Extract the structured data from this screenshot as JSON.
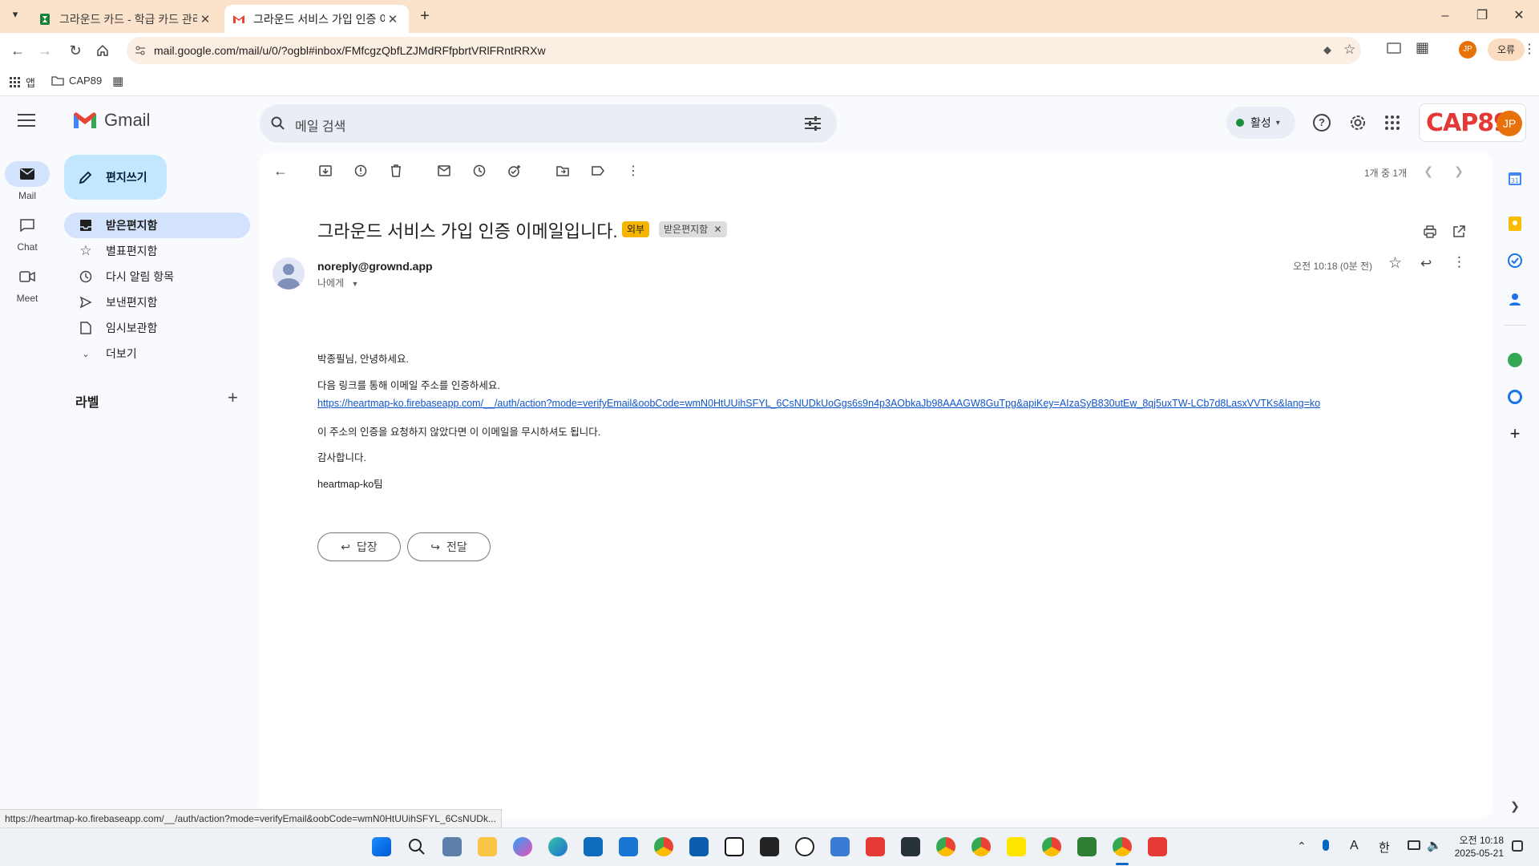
{
  "browser": {
    "tabs": [
      {
        "title": "그라운드 카드 - 학급 카드 관리",
        "active": false
      },
      {
        "title": "그라운드 서비스 가입 인증 이메일",
        "active": true
      }
    ],
    "url": "mail.google.com/mail/u/0/?ogbl#inbox/FMfcgzQbfLZJMdRFfpbrtVRlFRntRRXw",
    "error_chip": "오류",
    "profile_initials": "JP",
    "bookmarks": [
      {
        "label": "앱"
      },
      {
        "label": "CAP89"
      }
    ]
  },
  "gmail": {
    "logo_text": "Gmail",
    "search_placeholder": "메일 검색",
    "status": "활성",
    "brand_chip": "CAP89",
    "avatar": "JP",
    "rail": [
      {
        "label": "Mail",
        "selected": true
      },
      {
        "label": "Chat",
        "selected": false
      },
      {
        "label": "Meet",
        "selected": false
      }
    ],
    "compose": "편지쓰기",
    "nav": [
      {
        "label": "받은편지함",
        "selected": true
      },
      {
        "label": "별표편지함",
        "selected": false
      },
      {
        "label": "다시 알림 항목",
        "selected": false
      },
      {
        "label": "보낸편지함",
        "selected": false
      },
      {
        "label": "임시보관함",
        "selected": false
      },
      {
        "label": "더보기",
        "selected": false
      }
    ],
    "labels_header": "라벨",
    "pagination": "1개 중 1개"
  },
  "email": {
    "subject": "그라운드 서비스 가입 인증 이메일입니다.",
    "badge_external": "외부",
    "badge_inbox": "받은편지함",
    "sender": "noreply@grownd.app",
    "to": "나에게",
    "time": "오전 10:18 (0분 전)",
    "greeting": "박종필님, 안녕하세요.",
    "instruction": "다음 링크를 통해 이메일 주소를 인증하세요.",
    "link": "https://heartmap-ko.firebaseapp.com/__/auth/action?mode=verifyEmail&oobCode=wmN0HtUUihSFYL_6CsNUDkUoGgs6s9n4p3AObkaJb98AAAGW8GuTpg&apiKey=AIzaSyB830utEw_8qj5uxTW-LCb7d8LasxVVTKs&lang=ko",
    "ignore_note": "이 주소의 인증을 요청하지 않았다면 이 이메일을 무시하셔도 됩니다.",
    "thanks": "감사합니다.",
    "signature": "heartmap-ko팀",
    "reply_button": "답장",
    "forward_button": "전달"
  },
  "statusbar_url": "https://heartmap-ko.firebaseapp.com/__/auth/action?mode=verifyEmail&oobCode=wmN0HtUUihSFYL_6CsNUDk...",
  "taskbar": {
    "lang": "한",
    "ime": "A",
    "time": "오전 10:18",
    "date": "2025-05-21"
  },
  "colors": {
    "tab_strip": "#fbe3cb",
    "omnibox": "#fbeee2",
    "compose": "#c2e7ff",
    "selected_nav": "#d3e3fd",
    "link": "#1155cc",
    "external_badge": "#f4b400",
    "gmail_red": "#ea4335",
    "status_green": "#1e8e3e"
  }
}
